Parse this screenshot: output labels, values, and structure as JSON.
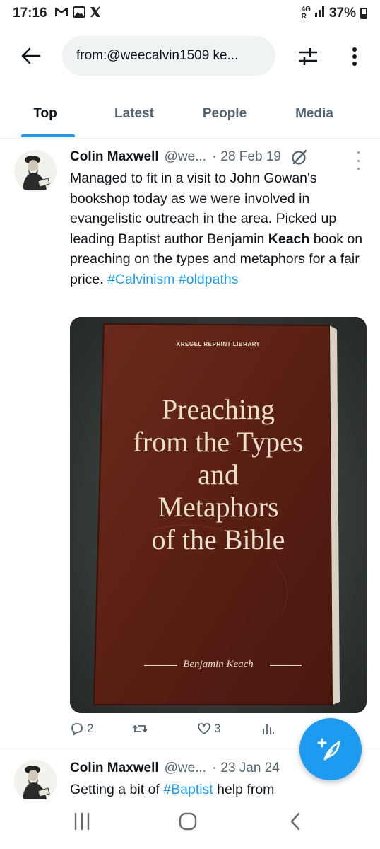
{
  "status_bar": {
    "time": "17:16",
    "notification_icons": [
      "gmail-icon",
      "gallery-icon",
      "x-icon"
    ],
    "network_label_top": "4G",
    "network_label_bottom": "R",
    "battery": "37%"
  },
  "search": {
    "query": "from:@weecalvin1509 ke..."
  },
  "tabs": [
    {
      "label": "Top",
      "active": true
    },
    {
      "label": "Latest",
      "active": false
    },
    {
      "label": "People",
      "active": false
    },
    {
      "label": "Media",
      "active": false
    }
  ],
  "tweets": [
    {
      "author_name": "Colin Maxwell",
      "handle": "@we...",
      "separator": "·",
      "date": "28 Feb 19",
      "text_parts": {
        "t1": "Managed to fit in a visit to John Gowan's bookshop today as we were involved in evangelistic outreach in the area. Picked up leading Baptist author Benjamin ",
        "bold": "Keach",
        "t2": " book on preaching on the types and metaphors for a fair price. ",
        "tag1": "#Calvinism",
        "tag2": "#oldpaths"
      },
      "image": {
        "publisher": "KREGEL REPRINT LIBRARY",
        "title_lines": [
          "Preaching",
          "from the Types",
          "and",
          "Metaphors",
          "of the Bible"
        ],
        "author": "Benjamin Keach"
      },
      "actions": {
        "replies": "2",
        "retweets": "",
        "likes": "3",
        "views": ""
      }
    },
    {
      "author_name": "Colin Maxwell",
      "handle": "@we...",
      "separator": "·",
      "date": "23 Jan 24",
      "text_parts": {
        "t1": "Getting a bit of ",
        "tag1": "#Baptist",
        "t2": " help from"
      }
    }
  ],
  "colors": {
    "accent": "#1d9bf0",
    "text_primary": "#0f1419",
    "text_secondary": "#536471",
    "book_cover": "#5a1f14",
    "book_lettering": "#e8e0c8"
  },
  "fab": {
    "icon": "compose-feather-icon"
  },
  "nav_bar": {
    "icons": [
      "recent-apps-icon",
      "home-icon",
      "back-icon"
    ]
  }
}
